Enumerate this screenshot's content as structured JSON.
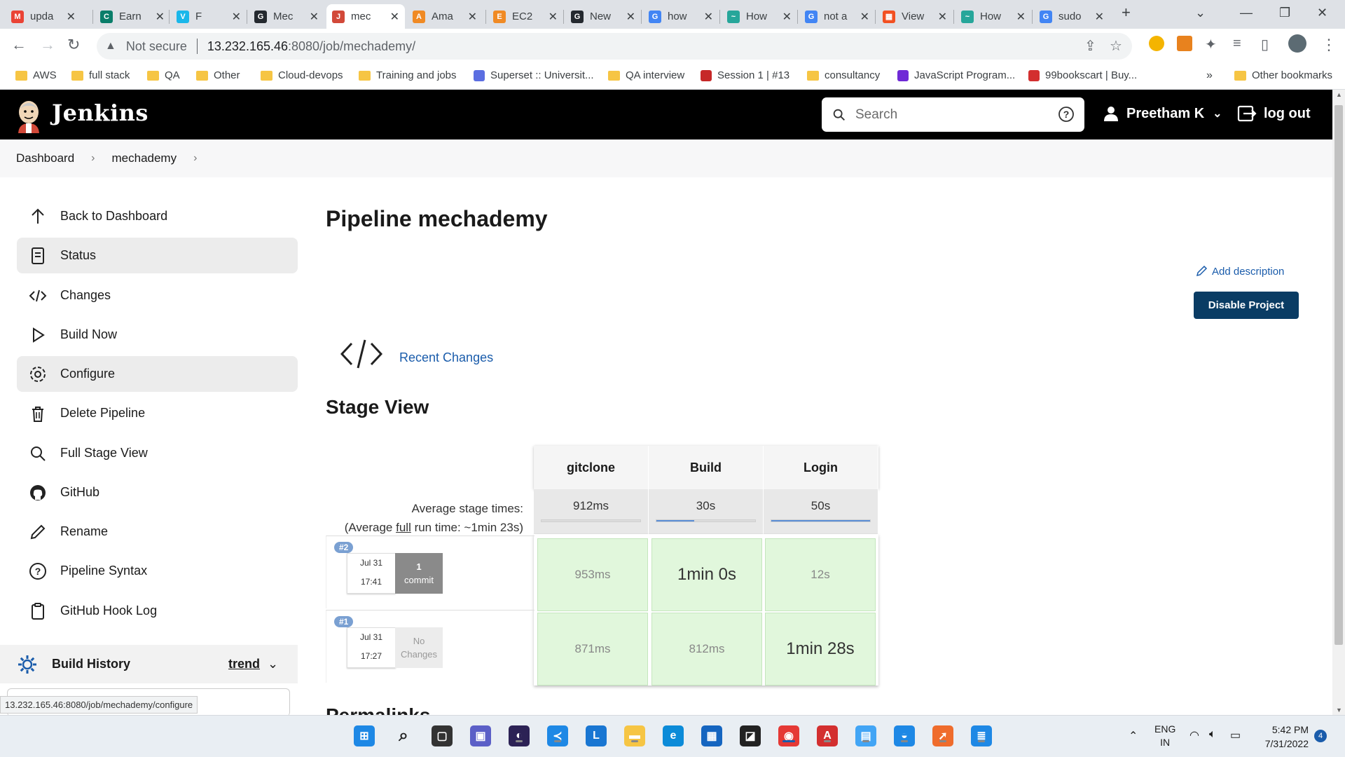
{
  "browser": {
    "tabs": [
      {
        "title": "upda",
        "icon": "gmail-icon",
        "color": "#ea4335",
        "glyph": "M"
      },
      {
        "title": "Earn",
        "icon": "coursera-icon",
        "color": "#0a7e6a",
        "glyph": "C"
      },
      {
        "title": "F",
        "icon": "vimeo-icon",
        "color": "#1ab7ea",
        "glyph": "V"
      },
      {
        "title": "Mec",
        "icon": "github-icon",
        "color": "#24292f",
        "glyph": "G"
      },
      {
        "title": "mec",
        "icon": "jenkins-icon",
        "color": "#d24939",
        "glyph": "J"
      },
      {
        "title": "Ama",
        "icon": "aws-icon",
        "color": "#f08a24",
        "glyph": "A"
      },
      {
        "title": "EC2",
        "icon": "aws-icon",
        "color": "#f08a24",
        "glyph": "E"
      },
      {
        "title": "New",
        "icon": "github-icon",
        "color": "#24292f",
        "glyph": "G"
      },
      {
        "title": "how",
        "icon": "google-icon",
        "color": "#4285f4",
        "glyph": "G"
      },
      {
        "title": "How",
        "icon": "eye-icon",
        "color": "#26a69a",
        "glyph": "~"
      },
      {
        "title": "not a",
        "icon": "google-icon",
        "color": "#4285f4",
        "glyph": "G"
      },
      {
        "title": "View",
        "icon": "microsoft-icon",
        "color": "#f25022",
        "glyph": "▦"
      },
      {
        "title": "How",
        "icon": "eye-icon",
        "color": "#26a69a",
        "glyph": "~"
      },
      {
        "title": "sudo",
        "icon": "google-icon",
        "color": "#4285f4",
        "glyph": "G"
      }
    ],
    "active_tab_index": 4,
    "security_label": "Not secure",
    "url_host": "13.232.165.46",
    "url_path": ":8080/job/mechademy/",
    "bookmarks": [
      {
        "label": "AWS",
        "type": "folder"
      },
      {
        "label": "full stack",
        "type": "folder"
      },
      {
        "label": "QA",
        "type": "folder"
      },
      {
        "label": "Other",
        "type": "folder"
      },
      {
        "label": "Cloud-devops",
        "type": "folder"
      },
      {
        "label": "Training and jobs",
        "type": "folder"
      },
      {
        "label": "Superset :: Universit...",
        "type": "site",
        "color": "#5b6ee1"
      },
      {
        "label": "QA interview",
        "type": "folder"
      },
      {
        "label": "Session 1 | #13",
        "type": "site",
        "color": "#c62828"
      },
      {
        "label": "consultancy",
        "type": "folder"
      },
      {
        "label": "JavaScript Program...",
        "type": "site",
        "color": "#6f2ad6"
      },
      {
        "label": "99bookscart | Buy...",
        "type": "site",
        "color": "#d32f2f"
      }
    ],
    "overflow_label": "»",
    "other_bookmarks": "Other bookmarks",
    "status_url": "13.232.165.46:8080/job/mechademy/configure"
  },
  "jenkins": {
    "brand": "Jenkins",
    "search_placeholder": "Search",
    "user_name": "Preetham K",
    "logout_label": "log out",
    "breadcrumb": [
      "Dashboard",
      "mechademy"
    ],
    "sidebar": [
      {
        "label": "Back to Dashboard",
        "icon": "arrow-up-icon",
        "selected": false
      },
      {
        "label": "Status",
        "icon": "document-icon",
        "selected": true
      },
      {
        "label": "Changes",
        "icon": "code-icon",
        "selected": false
      },
      {
        "label": "Build Now",
        "icon": "play-icon",
        "selected": false
      },
      {
        "label": "Configure",
        "icon": "gear-icon",
        "selected": true
      },
      {
        "label": "Delete Pipeline",
        "icon": "trash-icon",
        "selected": false
      },
      {
        "label": "Full Stage View",
        "icon": "search-icon",
        "selected": false
      },
      {
        "label": "GitHub",
        "icon": "github-icon",
        "selected": false
      },
      {
        "label": "Rename",
        "icon": "pencil-icon",
        "selected": false
      },
      {
        "label": "Pipeline Syntax",
        "icon": "help-circle-icon",
        "selected": false
      },
      {
        "label": "GitHub Hook Log",
        "icon": "clipboard-icon",
        "selected": false
      }
    ],
    "build_history": {
      "label": "Build History",
      "trend": "trend"
    },
    "page_title": "Pipeline mechademy",
    "add_description": "Add description",
    "disable_project": "Disable Project",
    "recent_changes": "Recent Changes",
    "stage_view_title": "Stage View",
    "stage_view": {
      "stages": [
        "gitclone",
        "Build",
        "Login"
      ],
      "avg_label_1": "Average stage times:",
      "avg_label_2a": "(Average ",
      "avg_label_2b": "full",
      "avg_label_2c": " run time: ~1min 23s)",
      "avg_times": [
        "912ms",
        "30s",
        "50s"
      ],
      "avg_fill": [
        0,
        0.38,
        1.0
      ],
      "runs": [
        {
          "number": "#2",
          "date": "Jul 31",
          "time": "17:41",
          "changes_1": "1",
          "changes_2": "commit",
          "has_changes": true,
          "durations": [
            "953ms",
            "1min 0s",
            "12s"
          ],
          "big": [
            false,
            true,
            false
          ]
        },
        {
          "number": "#1",
          "date": "Jul 31",
          "time": "17:27",
          "changes_1": "No",
          "changes_2": "Changes",
          "has_changes": false,
          "durations": [
            "871ms",
            "812ms",
            "1min 28s"
          ],
          "big": [
            false,
            false,
            true
          ]
        }
      ]
    },
    "permalinks_title": "Permalinks"
  },
  "taskbar": {
    "language_1": "ENG",
    "language_2": "IN",
    "time": "5:42 PM",
    "date": "7/31/2022",
    "notification_count": "4"
  },
  "colors": {
    "jenkins_header": "#000000",
    "button_primary": "#0a3c64",
    "link": "#1a5cab",
    "stage_success": "#e1f7dc"
  }
}
